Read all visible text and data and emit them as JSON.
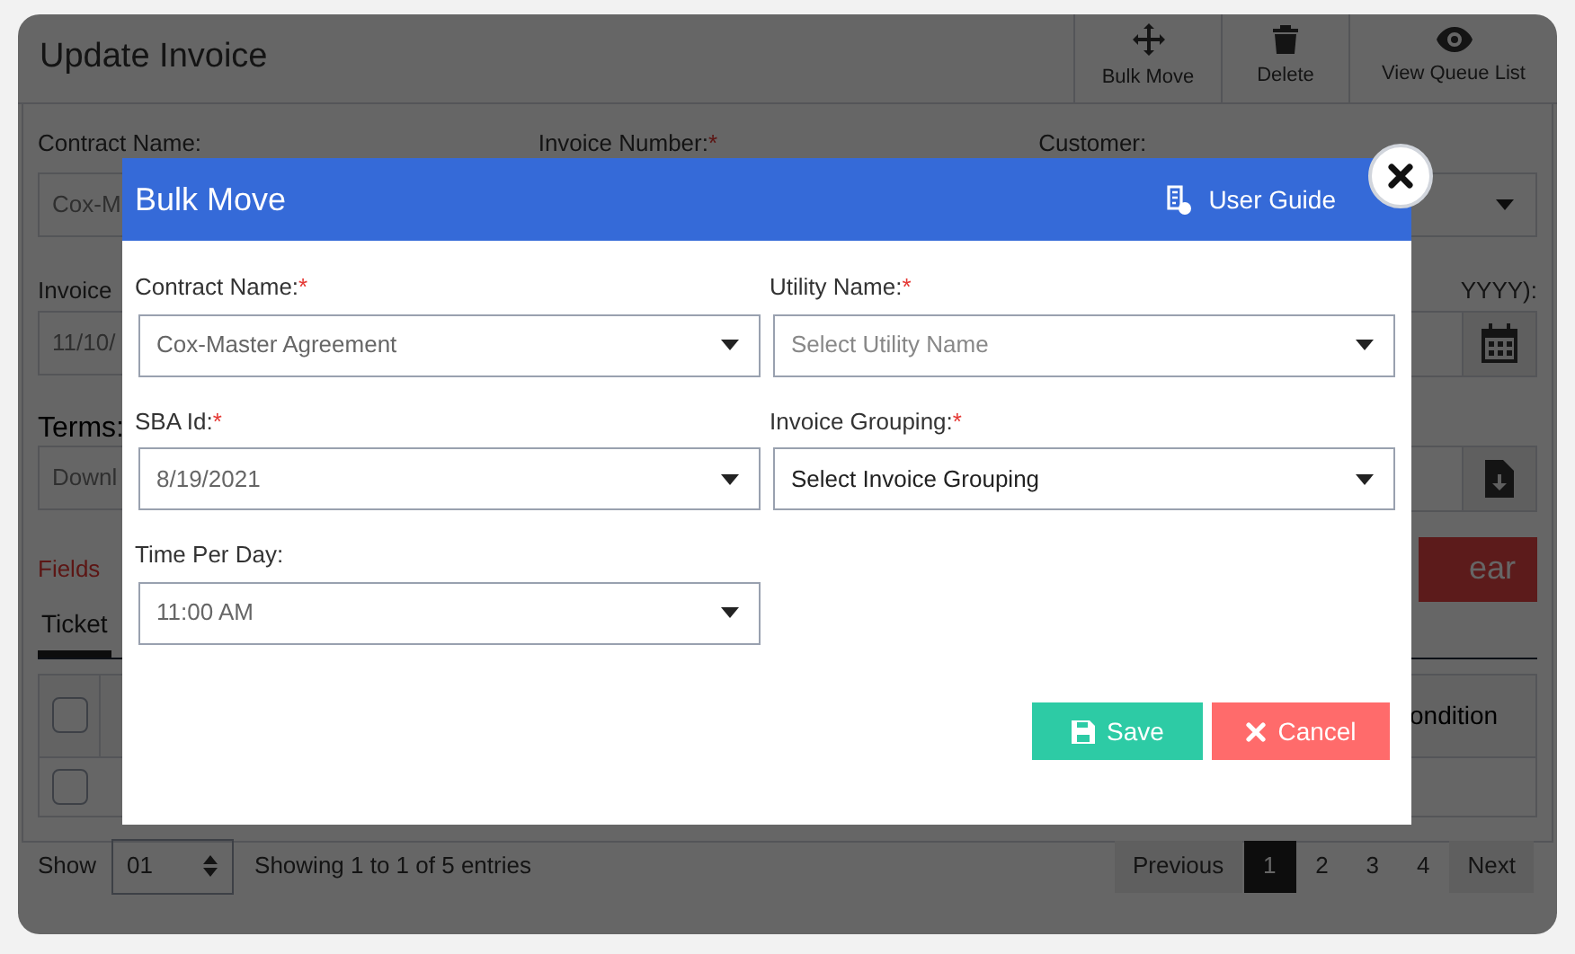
{
  "page": {
    "title": "Update Invoice",
    "toolbar": [
      {
        "label": "Bulk Move"
      },
      {
        "label": "Delete"
      },
      {
        "label": "View Queue List"
      }
    ],
    "labels": [
      {
        "text": "Contract Name:"
      },
      {
        "text": "Invoice Number:",
        "mark": "*"
      },
      {
        "text": "Customer:"
      }
    ],
    "left_labels": [
      "Invoice",
      "Terms:"
    ],
    "left_fields": [
      "Cox-M",
      "11/10/",
      "Downl"
    ],
    "right_label": "YYYY):",
    "alert": "Fields",
    "clear_button": "ear",
    "tabs": [
      {
        "label": "Ticket",
        "selected": true
      }
    ],
    "table": {
      "header": {
        "checked": false,
        "column_2": "ondition"
      },
      "rows": [
        {
          "checked": false
        }
      ]
    },
    "footer": {
      "show": "Show",
      "page_size": "01",
      "info": "Showing 1 to 1 of 5 entries",
      "pages": [
        {
          "label": "Previous",
          "selected": false
        },
        {
          "label": "1",
          "selected": true
        },
        {
          "label": "2",
          "selected": false
        },
        {
          "label": "3",
          "selected": false
        },
        {
          "label": "4",
          "selected": false
        },
        {
          "label": "Next",
          "selected": false
        }
      ]
    }
  },
  "dialog": {
    "title": "Bulk Move",
    "help": "User Guide",
    "fields": [
      {
        "label": "Contract Name:",
        "mark": "*",
        "value": "Cox-Master Agreement"
      },
      {
        "label": "Utility Name:",
        "mark": "*",
        "placeholder": "Select Utility Name"
      },
      {
        "label": "SBA Id:",
        "mark": "*",
        "value": "8/19/2021"
      },
      {
        "label": "Invoice Grouping:",
        "mark": "*",
        "value": "Select Invoice Grouping"
      },
      {
        "label": "Time Per Day:",
        "value": "11:00 AM"
      }
    ],
    "buttons": [
      {
        "label": "Save",
        "kind": "save"
      },
      {
        "label": "Cancel",
        "kind": "cancel"
      }
    ]
  }
}
